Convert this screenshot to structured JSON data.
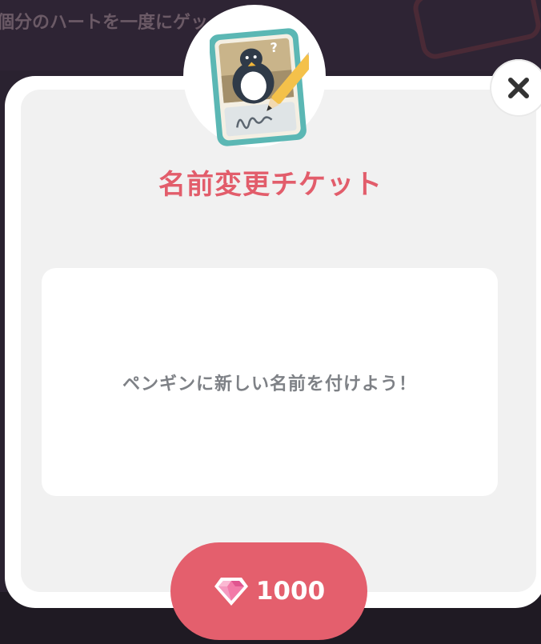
{
  "background": {
    "partial_text": "個分のハートを一度にゲッ"
  },
  "dialog": {
    "title": "名前変更チケット",
    "message": "ペンギンに新しい名前を付けよう！",
    "close_icon": "close-icon",
    "item_icon": "name-change-ticket-icon"
  },
  "purchase": {
    "currency_icon": "gem-icon",
    "price": "1000"
  },
  "colors": {
    "accent": "#e45f6d",
    "title": "#e25d6b",
    "panel": "#f1f1f1",
    "message_text": "#7e8186"
  }
}
